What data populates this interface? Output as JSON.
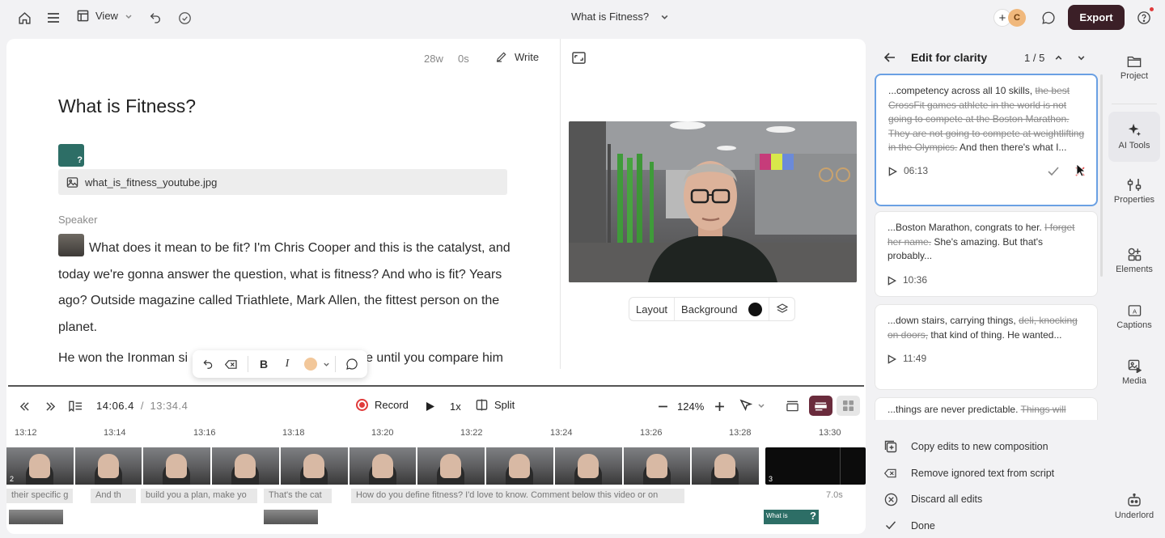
{
  "topbar": {
    "view_label": "View",
    "doc_title": "What is Fitness?",
    "avatar_letter": "C",
    "export_label": "Export"
  },
  "editor": {
    "word_count": "28w",
    "duration": "0s",
    "write_label": "Write",
    "title": "What is Fitness?",
    "thumb_glyph": "?",
    "image_filename": "what_is_fitness_youtube.jpg",
    "speaker_label": "Speaker",
    "paragraph1": "What does it mean to be fit? I'm Chris Cooper and this is the catalyst, and today we're gonna answer the question, what is fitness? And who is fit? Years ago? Outside magazine called Triathlete, Mark Allen, the fittest person on the planet.",
    "paragraph2_start": "He won the Ironman si",
    "paragraph2_end": "e until you compare him"
  },
  "stage": {
    "layout_label": "Layout",
    "background_label": "Background",
    "background_color": "#111111"
  },
  "timeline": {
    "current_time": "14:06.4",
    "separator": "/",
    "total_time": "13:34.4",
    "record_label": "Record",
    "speed": "1x",
    "split_label": "Split",
    "zoom": "124%",
    "ruler": [
      "13:12",
      "13:14",
      "13:16",
      "13:18",
      "13:20",
      "13:22",
      "13:24",
      "13:26",
      "13:28",
      "13:30"
    ],
    "clip_number_a": "2",
    "clip_number_b": "3",
    "captions": [
      "their specific g",
      "And th",
      "build you a plan, make yo",
      "That's the cat",
      "How do you define fitness? I'd love to know. Comment below this video or on"
    ],
    "end_duration": "7.0s",
    "end_thumb_text": "What is"
  },
  "panel": {
    "title": "Edit for clarity",
    "pager": "1 / 5",
    "cards": [
      {
        "before": "...competency across all 10 skills, ",
        "struck": "the best CrossFit games athlete in the world is not going to compete at the Boston Marathon. They are not going to compete at weightlifting in the Olympics.",
        "after": " And then there's what I...",
        "time": "06:13"
      },
      {
        "before": "...Boston Marathon, congrats to her. ",
        "struck": "I forget her name.",
        "after": " She's amazing. But that's probably...",
        "time": "10:36"
      },
      {
        "before": "...down stairs, carrying things, ",
        "struck": "deli, knocking on doors,",
        "after": " that kind of thing. He wanted...",
        "time": "11:49"
      },
      {
        "before": "...things are never predictable. ",
        "struck": "Things will",
        "after": "",
        "time": ""
      }
    ],
    "actions": [
      "Copy edits to new composition",
      "Remove ignored text from script",
      "Discard all edits",
      "Done"
    ]
  },
  "side_nav": {
    "items": [
      "Project",
      "AI Tools",
      "Properties",
      "Elements",
      "Captions",
      "Media",
      "Underlord"
    ]
  },
  "colors": {
    "export_bg": "#3b1f27",
    "active_card_border": "#6aa0e3",
    "record_red": "#e03b3b",
    "reject_red": "#e05050"
  }
}
